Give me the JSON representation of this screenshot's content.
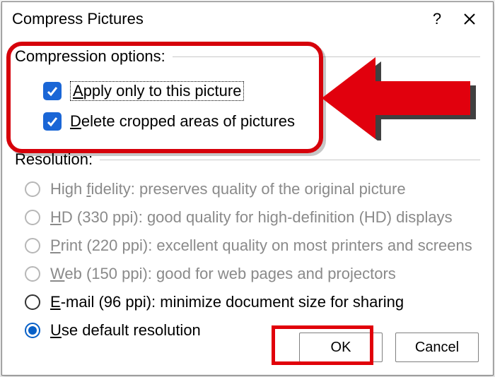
{
  "dialog": {
    "title": "Compress Pictures"
  },
  "compression": {
    "header": "Compression options:",
    "apply_only": "pply only to this picture",
    "apply_only_hotkey": "A",
    "delete_cropped": "elete cropped areas of pictures",
    "delete_cropped_hotkey": "D"
  },
  "resolution": {
    "header": "Resolution:",
    "high_fidelity_hotkey": "f",
    "high_fidelity_pre": "High ",
    "high_fidelity_post": "idelity: preserves quality of the original picture",
    "hd_hotkey": "H",
    "hd_post": "D (330 ppi): good quality for high-definition (HD) displays",
    "print_hotkey": "P",
    "print_post": "rint (220 ppi): excellent quality on most printers and screens",
    "web_hotkey": "W",
    "web_post": "eb (150 ppi): good for web pages and projectors",
    "email_hotkey": "E",
    "email_post": "-mail (96 ppi): minimize document size for sharing",
    "default_hotkey": "U",
    "default_post": "se default resolution"
  },
  "buttons": {
    "ok": "OK",
    "cancel": "Cancel"
  }
}
